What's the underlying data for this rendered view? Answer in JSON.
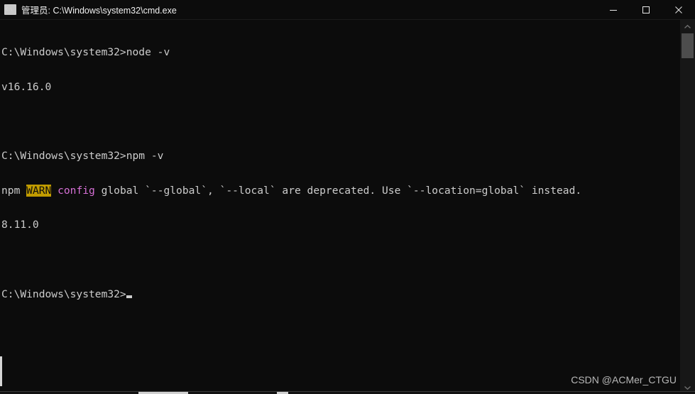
{
  "window": {
    "title": "管理员: C:\\Windows\\system32\\cmd.exe",
    "icon": "cmd-console-icon",
    "controls": {
      "minimize": "minimize-icon",
      "maximize": "maximize-icon",
      "close": "close-icon"
    }
  },
  "terminal": {
    "lines": [
      {
        "id": "l1",
        "text": "C:\\Windows\\system32>node -v"
      },
      {
        "id": "l2",
        "text": "v16.16.0"
      },
      {
        "id": "l3",
        "text": ""
      },
      {
        "id": "l4",
        "text": "C:\\Windows\\system32>npm -v"
      },
      {
        "id": "l5_a",
        "text": "npm "
      },
      {
        "id": "l5_warn",
        "text": "WARN"
      },
      {
        "id": "l5_b",
        "text": " "
      },
      {
        "id": "l5_config",
        "text": "config"
      },
      {
        "id": "l5_c",
        "text": " global `--global`, `--local` are deprecated. Use `--location=global` instead."
      },
      {
        "id": "l6",
        "text": "8.11.0"
      },
      {
        "id": "l7",
        "text": ""
      },
      {
        "id": "l8",
        "text": "C:\\Windows\\system32>"
      }
    ],
    "colors": {
      "background": "#0c0c0c",
      "foreground": "#cccccc",
      "warn_badge_bg": "#c19c00",
      "warn_badge_fg": "#0c0c0c",
      "magenta": "#d670d6"
    }
  },
  "scrollbar": {
    "up_arrow": "chevron-up-icon",
    "down_arrow": "chevron-down-icon"
  },
  "watermark": {
    "text": "CSDN @ACMer_CTGU"
  }
}
